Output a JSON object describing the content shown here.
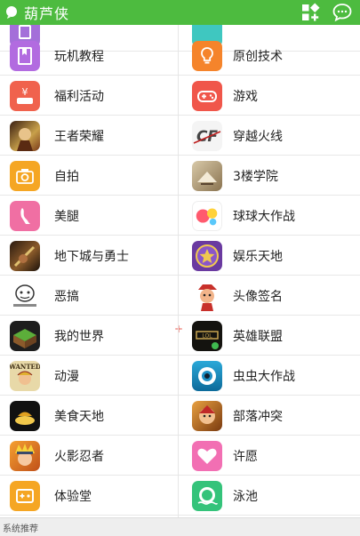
{
  "app": {
    "title": "葫芦侠"
  },
  "footer": {
    "label": "系统推荐"
  },
  "plus": "+",
  "colors": {
    "header": "#4dbb3f",
    "divider": "#e8e8e8"
  },
  "rows": [
    {
      "left": {
        "label": "",
        "icon": "purple-partial-icon"
      },
      "right": {
        "label": "",
        "icon": "teal-partial-icon"
      }
    },
    {
      "left": {
        "label": "玩机教程",
        "icon": "bookmark-icon"
      },
      "right": {
        "label": "原创技术",
        "icon": "lightbulb-icon"
      }
    },
    {
      "left": {
        "label": "福利活动",
        "icon": "welfare-yen-icon"
      },
      "right": {
        "label": "游戏",
        "icon": "gamepad-icon"
      }
    },
    {
      "left": {
        "label": "王者荣耀",
        "icon": "honor-of-kings-icon"
      },
      "right": {
        "label": "穿越火线",
        "icon": "crossfire-icon"
      }
    },
    {
      "left": {
        "label": "自拍",
        "icon": "camera-icon"
      },
      "right": {
        "label": "3楼学院",
        "icon": "books-icon"
      }
    },
    {
      "left": {
        "label": "美腿",
        "icon": "legs-icon"
      },
      "right": {
        "label": "球球大作战",
        "icon": "balls-icon"
      }
    },
    {
      "left": {
        "label": "地下城与勇士",
        "icon": "dungeon-fighter-icon"
      },
      "right": {
        "label": "娱乐天地",
        "icon": "star-badge-icon"
      }
    },
    {
      "left": {
        "label": "恶搞",
        "icon": "meme-face-icon"
      },
      "right": {
        "label": "头像签名",
        "icon": "avatar-character-icon"
      }
    },
    {
      "left": {
        "label": "我的世界",
        "icon": "minecraft-icon"
      },
      "right": {
        "label": "英雄联盟",
        "icon": "league-of-legends-icon"
      }
    },
    {
      "left": {
        "label": "动漫",
        "icon": "wanted-poster-icon"
      },
      "right": {
        "label": "虫虫大作战",
        "icon": "eye-monster-icon"
      }
    },
    {
      "left": {
        "label": "美食天地",
        "icon": "food-icon"
      },
      "right": {
        "label": "部落冲突",
        "icon": "clash-of-clans-icon"
      }
    },
    {
      "left": {
        "label": "火影忍者",
        "icon": "naruto-icon"
      },
      "right": {
        "label": "许愿",
        "icon": "heart-icon"
      }
    },
    {
      "left": {
        "label": "体验堂",
        "icon": "game-controller-icon"
      },
      "right": {
        "label": "泳池",
        "icon": "lifebuoy-icon"
      }
    }
  ]
}
